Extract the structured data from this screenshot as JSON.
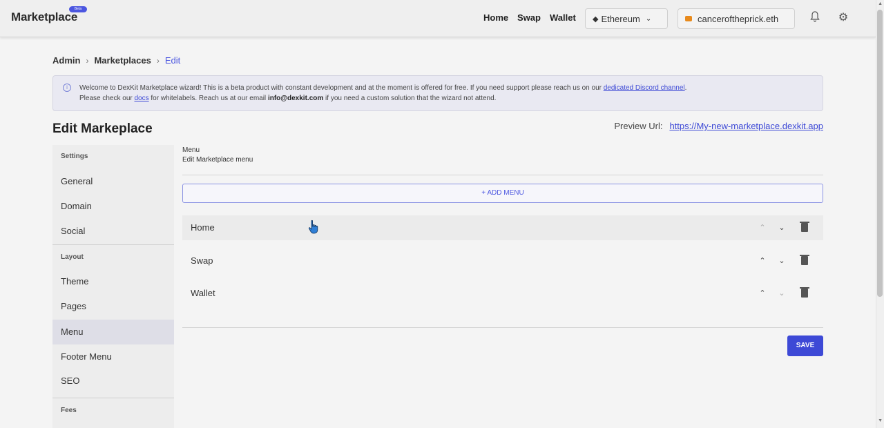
{
  "header": {
    "logo": "Marketplace",
    "badge": "Beta",
    "nav": [
      "Home",
      "Swap",
      "Wallet"
    ],
    "network": "Ethereum",
    "account": "canceroftheprick.eth",
    "icons": [
      "bell-icon",
      "gear-icon"
    ]
  },
  "breadcrumb": {
    "items": [
      "Admin",
      "Marketplaces"
    ],
    "current": "Edit"
  },
  "alert": {
    "line1_a": "Welcome to DexKit Marketplace wizard! This is a beta product with constant development and at the moment is offered for free. If you need support please reach us on our ",
    "line1_link": "dedicated Discord channel",
    "line1_b": ".",
    "line2_a": "Please check our ",
    "line2_link": "docs",
    "line2_b": " for whitelabels. Reach us at our email ",
    "line2_email": "info@dexkit.com",
    "line2_c": " if you need a custom solution that the wizard not attend."
  },
  "page": {
    "title": "Edit Markeplace",
    "preview_label": "Preview Url:",
    "preview_url": "https://My-new-marketplace.dexkit.app"
  },
  "sidebar": {
    "settings_header": "Settings",
    "settings_items": [
      "General",
      "Domain",
      "Social"
    ],
    "layout_header": "Layout",
    "layout_items": [
      "Theme",
      "Pages",
      "Menu",
      "Footer Menu",
      "SEO"
    ],
    "fees_header": "Fees",
    "active": "Menu"
  },
  "main": {
    "section_title": "Menu",
    "section_subtitle": "Edit Marketplace menu",
    "add_button": "+ ADD MENU",
    "menu_items": [
      "Home",
      "Swap",
      "Wallet"
    ],
    "save_button": "SAVE"
  },
  "colors": {
    "accent": "#3d49d6",
    "active_sidebar": "#dedee7"
  }
}
